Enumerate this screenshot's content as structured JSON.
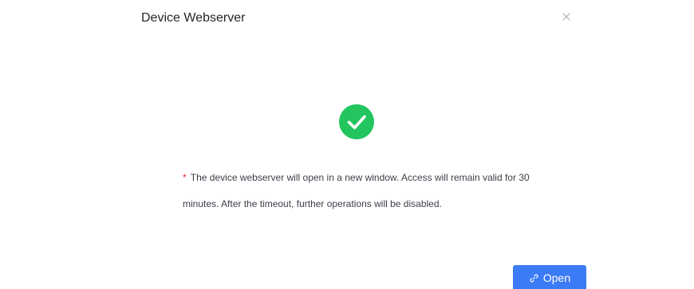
{
  "dialog": {
    "title": "Device Webserver",
    "close_icon": "close-icon"
  },
  "status": {
    "icon": "check-circle-icon",
    "icon_color": "#22c55e"
  },
  "message": {
    "required_marker": "*",
    "text": "The device webserver will open in a new window. Access will remain valid for 30 minutes. After the timeout, further operations will be disabled."
  },
  "actions": {
    "open_label": "Open",
    "open_icon": "link-icon",
    "accent_color": "#3b7bf6"
  }
}
